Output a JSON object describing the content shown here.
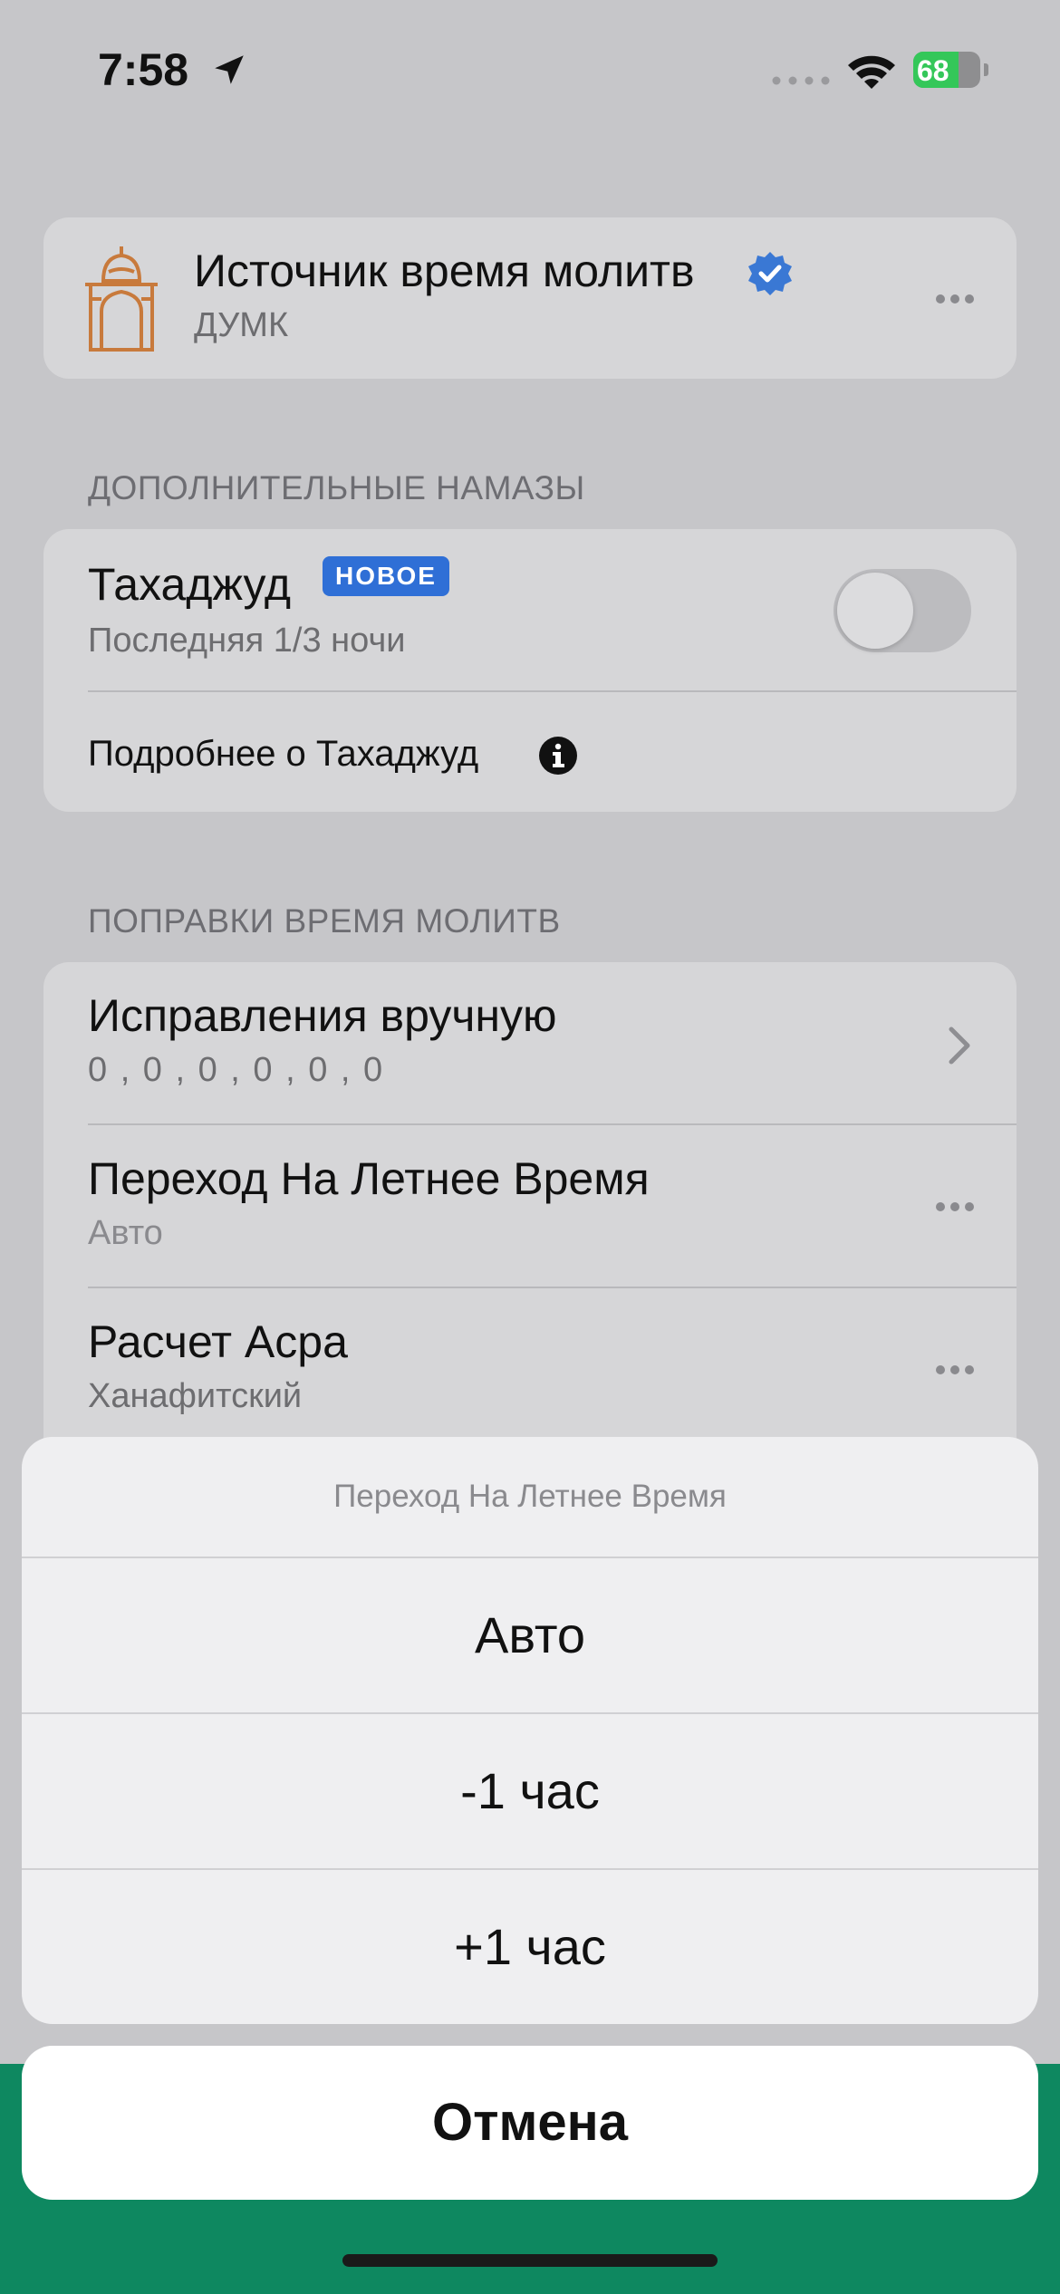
{
  "status_bar": {
    "time": "7:58",
    "battery": "68",
    "battery_fraction": 0.68
  },
  "source_card": {
    "title": "Источник время молитв",
    "subtitle": "ДУМК",
    "icon": "mosque-icon"
  },
  "extra_prayers": {
    "header": "ДОПОЛНИТЕЛЬНЫЕ НАМАЗЫ",
    "tahajjud": {
      "title": "Тахаджуд",
      "badge": "НОВОЕ",
      "subtitle": "Последняя 1/3 ночи",
      "enabled": false
    },
    "more_link": "Подробнее о Тахаджуд"
  },
  "adjustments": {
    "header": "ПОПРАВКИ ВРЕМЯ МОЛИТВ",
    "rows": [
      {
        "title": "Исправления вручную",
        "subtitle": "0 , 0 , 0 , 0 , 0 , 0"
      },
      {
        "title": "Переход На Летнее Время",
        "subtitle": "Авто"
      },
      {
        "title": "Расчет Асра",
        "subtitle": "Ханафитский"
      }
    ]
  },
  "action_sheet": {
    "title": "Переход На Летнее Время",
    "options": [
      "Авто",
      "-1 час",
      "+1 час"
    ],
    "cancel": "Отмена"
  },
  "colors": {
    "accent_green": "#0e8860",
    "badge_blue": "#2f6fd6",
    "battery_green": "#34c759",
    "mosque_orange": "#c87a3c"
  }
}
